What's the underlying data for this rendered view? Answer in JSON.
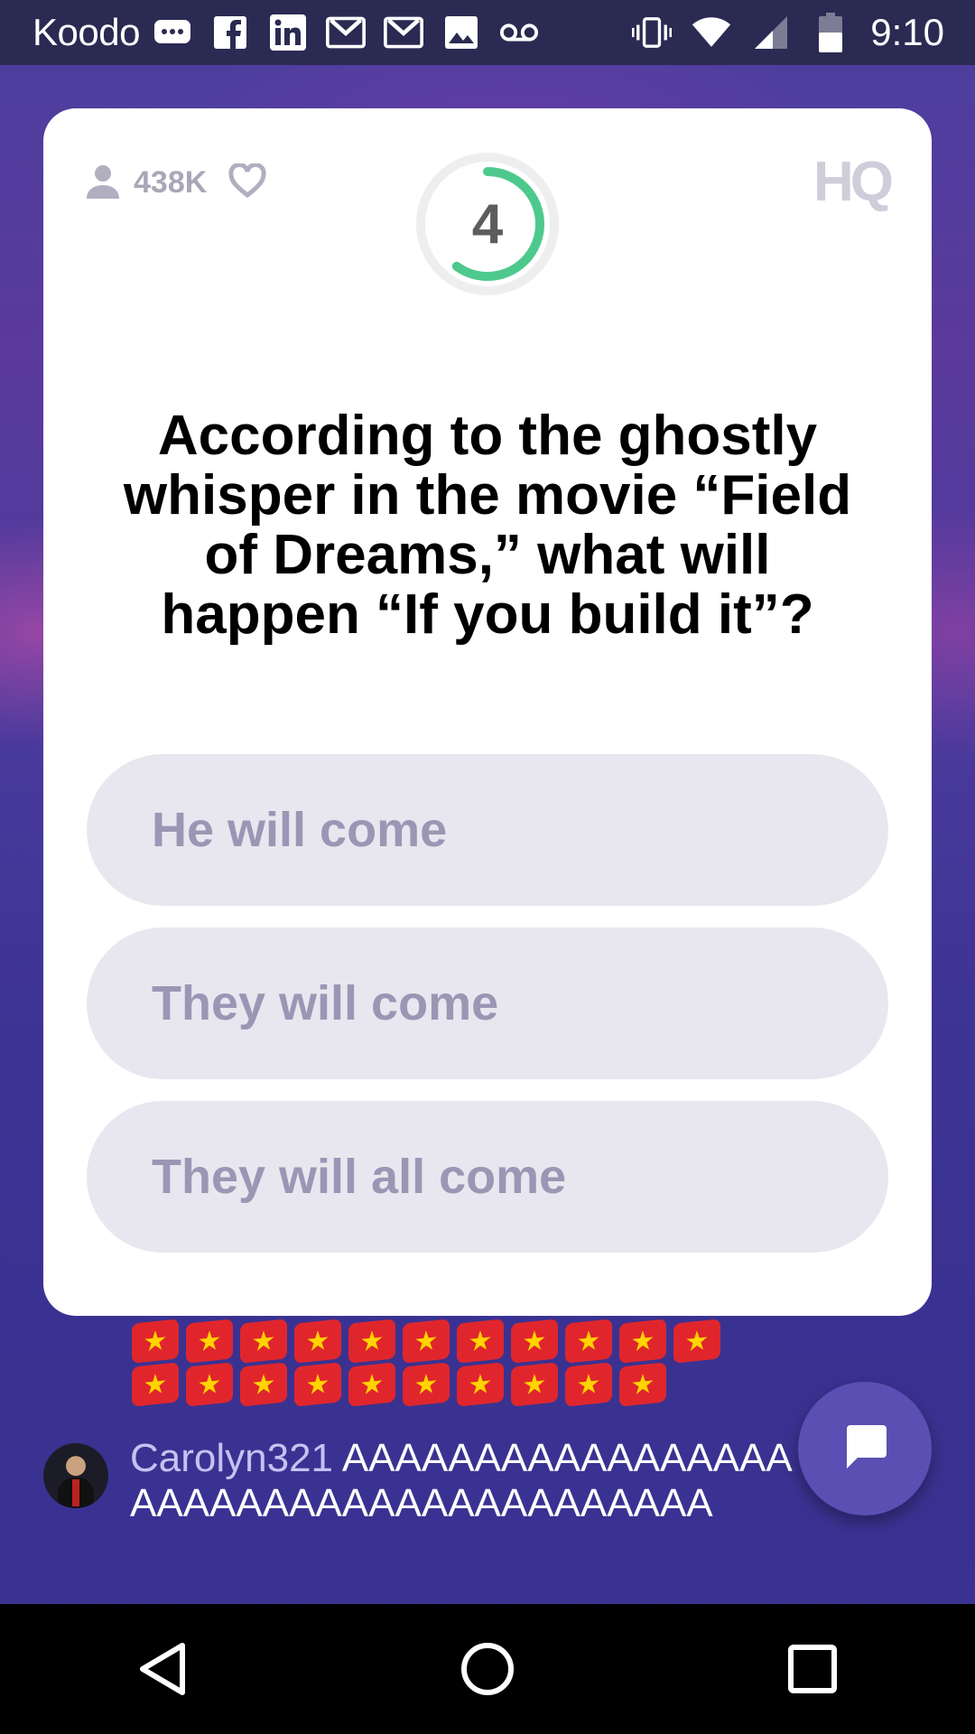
{
  "status_bar": {
    "carrier": "Koodo",
    "time": "9:10",
    "left_icons": [
      "chat-bubble-icon",
      "facebook-icon",
      "linkedin-icon",
      "gmail-icon",
      "gmail-icon",
      "image-icon",
      "voicemail-icon"
    ],
    "right_icons": [
      "vibrate-icon",
      "wifi-icon",
      "signal-icon",
      "battery-icon"
    ]
  },
  "game": {
    "viewer_count": "438K",
    "timer_value": "4",
    "timer_progress": 0.6,
    "logo": "HQ",
    "question": "According to the ghostly whisper in the movie “Field of Dreams,” what will happen “If you build it”?",
    "answers": [
      {
        "label": "He will come"
      },
      {
        "label": "They will come"
      },
      {
        "label": "They will all come"
      }
    ]
  },
  "reactions": {
    "flag_emoji": "🇻🇳",
    "row1_count": 11,
    "row2_count": 10
  },
  "chat": {
    "username": "Carolyn321",
    "message": "AAAAAAAAAAAAAAAAAAAAAAAAAAAAAAAAAAAAAAA"
  },
  "colors": {
    "accent_green": "#4ec98d",
    "card_bg": "#ffffff",
    "answer_bg": "#e8e7ef",
    "answer_text": "#9a97b5",
    "fab_bg": "#5b4fb4"
  }
}
